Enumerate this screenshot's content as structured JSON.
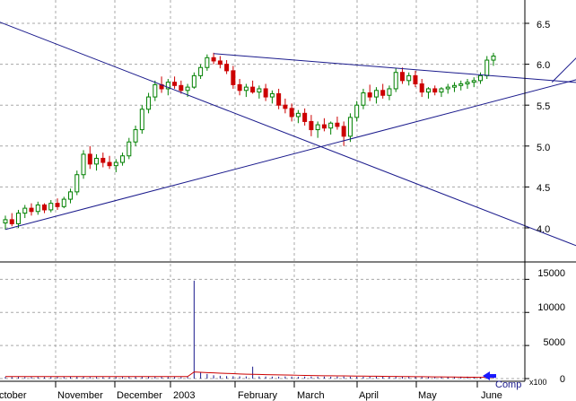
{
  "chart_data": [
    {
      "type": "candlestick",
      "panel": "price",
      "ylim": [
        3.6,
        6.6
      ],
      "y_ticks": [
        "4.0",
        "4.5",
        "5.0",
        "5.5",
        "6.0",
        "6.5"
      ],
      "x_month_labels": [
        "ctober",
        "November",
        "December",
        "2003",
        "February",
        "March",
        "April",
        "May",
        "June"
      ],
      "grid": true,
      "colors": {
        "up": "#008000",
        "down": "#cc0000",
        "trendline": "#1a1a8c",
        "grid": "#a8a8a8"
      },
      "ohlc": [
        [
          4.06,
          4.15,
          3.98,
          4.1
        ],
        [
          4.1,
          4.18,
          4.02,
          4.05
        ],
        [
          4.05,
          4.22,
          4.0,
          4.18
        ],
        [
          4.18,
          4.28,
          4.12,
          4.24
        ],
        [
          4.24,
          4.3,
          4.15,
          4.2
        ],
        [
          4.2,
          4.32,
          4.16,
          4.28
        ],
        [
          4.28,
          4.3,
          4.18,
          4.22
        ],
        [
          4.22,
          4.34,
          4.19,
          4.3
        ],
        [
          4.3,
          4.36,
          4.22,
          4.26
        ],
        [
          4.26,
          4.38,
          4.24,
          4.35
        ],
        [
          4.35,
          4.48,
          4.3,
          4.44
        ],
        [
          4.44,
          4.7,
          4.4,
          4.65
        ],
        [
          4.65,
          4.95,
          4.6,
          4.9
        ],
        [
          4.9,
          5.0,
          4.72,
          4.78
        ],
        [
          4.78,
          4.9,
          4.7,
          4.85
        ],
        [
          4.85,
          4.92,
          4.74,
          4.8
        ],
        [
          4.8,
          4.88,
          4.72,
          4.76
        ],
        [
          4.76,
          4.84,
          4.68,
          4.8
        ],
        [
          4.8,
          4.92,
          4.76,
          4.88
        ],
        [
          4.88,
          5.1,
          4.84,
          5.05
        ],
        [
          5.05,
          5.25,
          5.0,
          5.2
        ],
        [
          5.2,
          5.5,
          5.15,
          5.45
        ],
        [
          5.45,
          5.65,
          5.4,
          5.6
        ],
        [
          5.6,
          5.8,
          5.55,
          5.75
        ],
        [
          5.75,
          5.85,
          5.65,
          5.7
        ],
        [
          5.7,
          5.82,
          5.62,
          5.78
        ],
        [
          5.78,
          5.85,
          5.7,
          5.74
        ],
        [
          5.74,
          5.8,
          5.64,
          5.68
        ],
        [
          5.68,
          5.76,
          5.6,
          5.72
        ],
        [
          5.72,
          5.9,
          5.7,
          5.86
        ],
        [
          5.86,
          6.0,
          5.82,
          5.96
        ],
        [
          5.96,
          6.12,
          5.92,
          6.08
        ],
        [
          6.08,
          6.14,
          6.0,
          6.04
        ],
        [
          6.04,
          6.1,
          5.95,
          6.0
        ],
        [
          6.0,
          6.05,
          5.88,
          5.92
        ],
        [
          5.92,
          5.98,
          5.7,
          5.75
        ],
        [
          5.75,
          5.82,
          5.62,
          5.68
        ],
        [
          5.68,
          5.76,
          5.6,
          5.72
        ],
        [
          5.72,
          5.8,
          5.64,
          5.66
        ],
        [
          5.66,
          5.74,
          5.58,
          5.7
        ],
        [
          5.7,
          5.76,
          5.55,
          5.6
        ],
        [
          5.6,
          5.68,
          5.52,
          5.64
        ],
        [
          5.64,
          5.7,
          5.45,
          5.5
        ],
        [
          5.5,
          5.58,
          5.4,
          5.46
        ],
        [
          5.46,
          5.52,
          5.3,
          5.36
        ],
        [
          5.36,
          5.44,
          5.28,
          5.4
        ],
        [
          5.4,
          5.46,
          5.25,
          5.3
        ],
        [
          5.3,
          5.38,
          5.12,
          5.2
        ],
        [
          5.2,
          5.3,
          5.1,
          5.26
        ],
        [
          5.26,
          5.34,
          5.18,
          5.22
        ],
        [
          5.22,
          5.3,
          5.14,
          5.28
        ],
        [
          5.28,
          5.36,
          5.2,
          5.24
        ],
        [
          5.24,
          5.3,
          5.0,
          5.12
        ],
        [
          5.12,
          5.4,
          5.05,
          5.35
        ],
        [
          5.35,
          5.55,
          5.3,
          5.5
        ],
        [
          5.5,
          5.7,
          5.45,
          5.65
        ],
        [
          5.65,
          5.75,
          5.55,
          5.6
        ],
        [
          5.6,
          5.72,
          5.52,
          5.68
        ],
        [
          5.68,
          5.76,
          5.58,
          5.62
        ],
        [
          5.62,
          5.74,
          5.56,
          5.7
        ],
        [
          5.7,
          5.95,
          5.66,
          5.9
        ],
        [
          5.9,
          5.96,
          5.76,
          5.8
        ],
        [
          5.8,
          5.9,
          5.74,
          5.86
        ],
        [
          5.86,
          5.92,
          5.72,
          5.76
        ],
        [
          5.76,
          5.82,
          5.6,
          5.66
        ],
        [
          5.66,
          5.72,
          5.58,
          5.7
        ],
        [
          5.7,
          5.74,
          5.62,
          5.66
        ],
        [
          5.66,
          5.72,
          5.6,
          5.7
        ],
        [
          5.7,
          5.76,
          5.64,
          5.72
        ],
        [
          5.72,
          5.78,
          5.66,
          5.74
        ],
        [
          5.74,
          5.8,
          5.68,
          5.76
        ],
        [
          5.76,
          5.82,
          5.7,
          5.78
        ],
        [
          5.78,
          5.84,
          5.72,
          5.8
        ],
        [
          5.8,
          5.9,
          5.76,
          5.86
        ],
        [
          5.86,
          6.1,
          5.82,
          6.05
        ],
        [
          6.05,
          6.14,
          5.98,
          6.1
        ]
      ],
      "trendlines": [
        {
          "name": "long-downtrend",
          "from": [
            -2,
            6.55
          ],
          "to": [
            92,
            3.65
          ]
        },
        {
          "name": "uptrend-support",
          "from": [
            0,
            3.98
          ],
          "to": [
            92,
            5.9
          ]
        },
        {
          "name": "upper-resistance",
          "from": [
            32,
            6.13
          ],
          "to": [
            92,
            5.75
          ]
        },
        {
          "name": "breakout-ray",
          "from": [
            84,
            5.78
          ],
          "to": [
            89,
            6.18
          ]
        }
      ]
    },
    {
      "type": "bar",
      "panel": "volume",
      "ylim": [
        0,
        16000
      ],
      "y_ticks": [
        "0",
        "5000",
        "10000",
        "15000"
      ],
      "multiplier_label": "x100",
      "overlay_label": "Comp",
      "colors": {
        "bar": "#1a1a8c",
        "average": "#cc0000",
        "arrow": "#1a1aff"
      },
      "volume": [
        260,
        240,
        250,
        230,
        220,
        240,
        210,
        230,
        250,
        240,
        260,
        280,
        300,
        240,
        230,
        220,
        210,
        220,
        240,
        260,
        280,
        300,
        320,
        280,
        260,
        250,
        240,
        230,
        250,
        14800,
        900,
        700,
        500,
        420,
        380,
        360,
        340,
        330,
        1800,
        320,
        310,
        300,
        290,
        320,
        300,
        280,
        300,
        310,
        290,
        300,
        280,
        300,
        310,
        290,
        280,
        270,
        290,
        300,
        280,
        270,
        260,
        280,
        270,
        290,
        280,
        300,
        270,
        260,
        280,
        270,
        290,
        300,
        280,
        270,
        260,
        250
      ],
      "average": [
        300,
        300,
        300,
        300,
        300,
        300,
        300,
        300,
        300,
        300,
        300,
        300,
        300,
        300,
        300,
        300,
        300,
        300,
        300,
        300,
        300,
        300,
        300,
        300,
        300,
        300,
        300,
        300,
        300,
        1000,
        950,
        900,
        860,
        820,
        780,
        740,
        700,
        660,
        640,
        620,
        600,
        580,
        560,
        540,
        520,
        500,
        480,
        460,
        440,
        430,
        420,
        410,
        400,
        390,
        380,
        370,
        360,
        350,
        340,
        330,
        320,
        310,
        300,
        290,
        280,
        270,
        260,
        250,
        240,
        230,
        220,
        210,
        200,
        190,
        180,
        170
      ]
    }
  ]
}
